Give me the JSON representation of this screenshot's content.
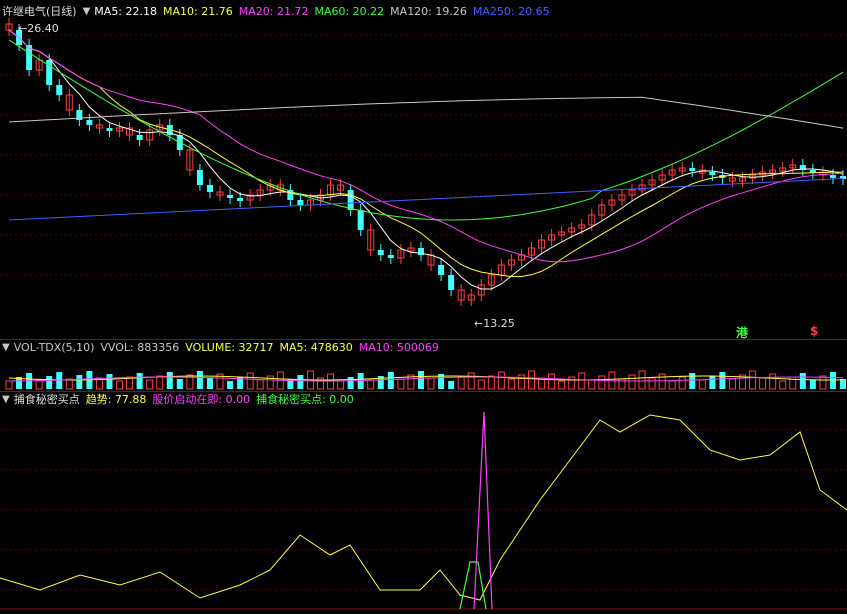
{
  "main_panel": {
    "stock_name": "许继电气(日线)",
    "ma_items": [
      {
        "label": "MA5: 22.18",
        "color": "#ffffff"
      },
      {
        "label": "MA10: 21.76",
        "color": "#ffff40"
      },
      {
        "label": "MA20: 21.72",
        "color": "#ff40ff"
      },
      {
        "label": "MA60: 20.22",
        "color": "#40ff40"
      },
      {
        "label": "MA120: 19.26",
        "color": "#c8c8c8"
      },
      {
        "label": "MA250: 20.65",
        "color": "#4060ff"
      }
    ],
    "high_label": "26.40",
    "low_label": "13.25",
    "tag_gang": "港",
    "tag_dollar": "$"
  },
  "volume_panel": {
    "items": [
      {
        "label": "VOL-TDX(5,10)",
        "color": "#c8c8c8"
      },
      {
        "label": "VVOL: 883356",
        "color": "#c8c8c8"
      },
      {
        "label": "VOLUME: 32717",
        "color": "#ffff40"
      },
      {
        "label": "MA5: 478630",
        "color": "#ffff40"
      },
      {
        "label": "MA10: 500069",
        "color": "#ff40ff"
      }
    ]
  },
  "indicator_panel": {
    "title": "捕食秘密买点",
    "items": [
      {
        "label": "趋势: 77.88",
        "color": "#ffff40"
      },
      {
        "label": "股价启动在即: 0.00",
        "color": "#ff40ff"
      },
      {
        "label": "捕食秘密买点: 0.00",
        "color": "#40ff40"
      }
    ]
  },
  "colors": {
    "up": "#ff4040",
    "down": "#40ffff",
    "ma5": "#ffffff",
    "ma10": "#ffff40",
    "ma20": "#ff40ff",
    "ma60": "#40ff40",
    "ma120": "#c8c8c8",
    "ma250": "#4060ff"
  }
}
